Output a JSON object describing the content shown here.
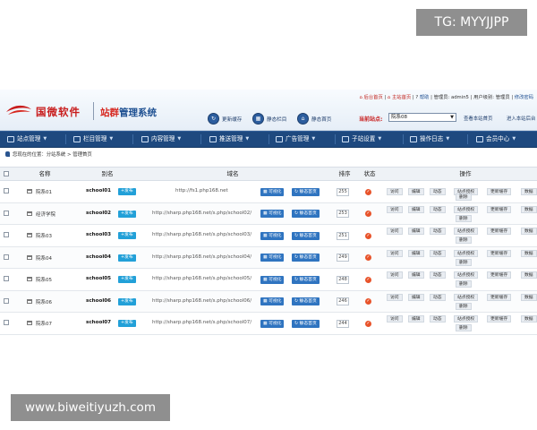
{
  "watermarks": {
    "top": "TG: MYYJJPP",
    "bottom": "www.biweitiyuzh.com"
  },
  "header": {
    "logo_text": "国微软件",
    "subtitle_a": "站群",
    "subtitle_b": "管理系统",
    "topbar": {
      "backend_home": "后台首页",
      "site_home": "主站首页",
      "help": "帮助",
      "admin_label": "管理员: admin5",
      "user_level": "用户级别: 管理员",
      "change_password": "修改密码"
    },
    "quick_actions": [
      {
        "label": "更新缓存",
        "icon": "refresh-icon"
      },
      {
        "label": "静态栏目",
        "icon": "grid-icon"
      },
      {
        "label": "静态首页",
        "icon": "home-icon"
      }
    ],
    "current_site_label": "当前站点:",
    "current_site_value": "院系08",
    "visit_site": "查看本站首页",
    "enter_site": "进入本站后台"
  },
  "nav": [
    {
      "label": "站点管理",
      "icon": "list-icon"
    },
    {
      "label": "栏目管理",
      "icon": "folder-icon"
    },
    {
      "label": "内容管理",
      "icon": "document-icon"
    },
    {
      "label": "推送管理",
      "icon": "send-icon"
    },
    {
      "label": "广告管理",
      "icon": "ad-icon"
    },
    {
      "label": "子站设置",
      "icon": "monitor-icon"
    },
    {
      "label": "操作日志",
      "icon": "log-icon"
    },
    {
      "label": "会员中心",
      "icon": "users-icon"
    }
  ],
  "breadcrumb": "您现在的位置：分站系统 > 管理首页",
  "table": {
    "headers": {
      "name": "名称",
      "alias": "别名",
      "domain": "域名",
      "sort": "排序",
      "status": "状态",
      "ops": "操作"
    },
    "publish_label": "+发布",
    "visualize_label": "可视化",
    "static_label": "静态首页",
    "op_labels": [
      "访问",
      "编辑",
      "动态",
      "站点授权",
      "更新缓存",
      "数据",
      "删除"
    ],
    "rows": [
      {
        "name": "院系01",
        "alias": "school01",
        "domain": "http://fs1.php168.net",
        "sort": "255"
      },
      {
        "name": "经济学院",
        "alias": "school02",
        "domain": "http://sharp.php168.net/s.php/school02/",
        "sort": "253"
      },
      {
        "name": "院系03",
        "alias": "school03",
        "domain": "http://sharp.php168.net/s.php/school03/",
        "sort": "251"
      },
      {
        "name": "院系04",
        "alias": "school04",
        "domain": "http://sharp.php168.net/s.php/school04/",
        "sort": "249"
      },
      {
        "name": "院系05",
        "alias": "school05",
        "domain": "http://sharp.php168.net/s.php/school05/",
        "sort": "248"
      },
      {
        "name": "院系06",
        "alias": "school06",
        "domain": "http://sharp.php168.net/s.php/school06/",
        "sort": "246"
      },
      {
        "name": "院系07",
        "alias": "school07",
        "domain": "http://sharp.php168.net/s.php/school07/",
        "sort": "244"
      }
    ]
  }
}
